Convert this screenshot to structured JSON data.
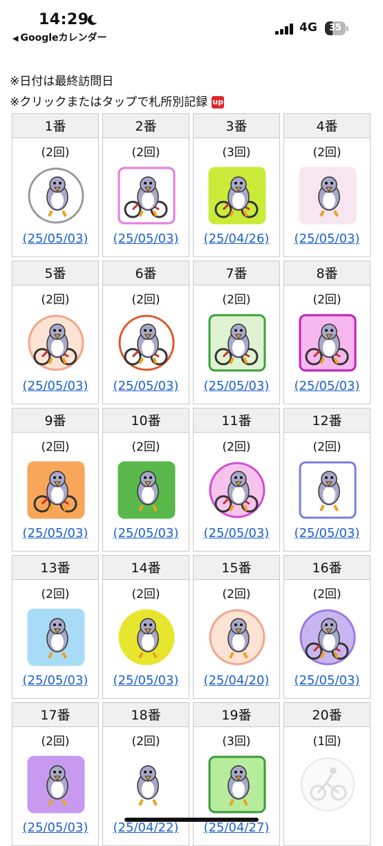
{
  "status_bar": {
    "time": "14:29",
    "back_label": "Googleカレンダー",
    "network": "4G",
    "battery": "35",
    "battery_level": 0.35
  },
  "notes": {
    "line1": "※日付は最終訪問日",
    "line2": "※クリックまたはタップで札所別記録",
    "badge": "up"
  },
  "temples": [
    {
      "number": "1番",
      "visits": "(2回)",
      "date": "(25/05/03)",
      "icon": "pilgrim-penguin-hat",
      "bg": "#ffffff",
      "ring": "#9a9a9a",
      "shape": "circle"
    },
    {
      "number": "2番",
      "visits": "(2回)",
      "date": "(25/05/03)",
      "icon": "penguin-bicycle",
      "bg": "#ffffff",
      "ring": "#e77ae0",
      "shape": "square"
    },
    {
      "number": "3番",
      "visits": "(3回)",
      "date": "(25/04/26)",
      "icon": "penguin-bicycle-front",
      "bg": "#c9ec3a",
      "ring": "#c9ec3a",
      "shape": "square"
    },
    {
      "number": "4番",
      "visits": "(2回)",
      "date": "(25/05/03)",
      "icon": "penguin-cherry-blossom",
      "bg": "#f7e6f0",
      "ring": "#f7e6f0",
      "shape": "square"
    },
    {
      "number": "5番",
      "visits": "(2回)",
      "date": "(25/05/03)",
      "icon": "penguin-red-bicycle",
      "bg": "#fde3d4",
      "ring": "#f2a58a",
      "shape": "circle"
    },
    {
      "number": "6番",
      "visits": "(2回)",
      "date": "(25/05/03)",
      "icon": "penguin-riding-bicycle",
      "bg": "#ffffff",
      "ring": "#e2552a",
      "shape": "circle"
    },
    {
      "number": "7番",
      "visits": "(2回)",
      "date": "(25/05/03)",
      "icon": "penguin-bicycle-greenhouse",
      "bg": "#dff3d2",
      "ring": "#3aa13a",
      "shape": "square"
    },
    {
      "number": "8番",
      "visits": "(2回)",
      "date": "(25/05/03)",
      "icon": "penguin-helmet-bicycle",
      "bg": "#f6b8ee",
      "ring": "#c020b8",
      "shape": "square"
    },
    {
      "number": "9番",
      "visits": "(2回)",
      "date": "(25/05/03)",
      "icon": "penguin-bicycle-pump",
      "bg": "#f7a65a",
      "ring": "#f7a65a",
      "shape": "square"
    },
    {
      "number": "10番",
      "visits": "(2回)",
      "date": "(25/05/03)",
      "icon": "penguin-resting-grass",
      "bg": "#58b84a",
      "ring": "#58b84a",
      "shape": "square"
    },
    {
      "number": "11番",
      "visits": "(2回)",
      "date": "(25/05/03)",
      "icon": "penguin-bicycle-pink",
      "bg": "#f5c3ec",
      "ring": "#d24ad0",
      "shape": "circle"
    },
    {
      "number": "12番",
      "visits": "(2回)",
      "date": "(25/05/03)",
      "icon": "penguin-helmet-rock",
      "bg": "#ffffff",
      "ring": "#7c7ce6",
      "shape": "square"
    },
    {
      "number": "13番",
      "visits": "(2回)",
      "date": "(25/05/03)",
      "icon": "penguin-cooking",
      "bg": "#a8dcf6",
      "ring": "#a8dcf6",
      "shape": "square"
    },
    {
      "number": "14番",
      "visits": "(2回)",
      "date": "(25/05/03)",
      "icon": "penguin-udon-making",
      "bg": "#e7e62e",
      "ring": "#e7e62e",
      "shape": "circle"
    },
    {
      "number": "15番",
      "visits": "(2回)",
      "date": "(25/04/20)",
      "icon": "festival-float",
      "bg": "#fde3d4",
      "ring": "#f0a68b",
      "shape": "circle"
    },
    {
      "number": "16番",
      "visits": "(2回)",
      "date": "(25/05/03)",
      "icon": "penguin-bicycle-night",
      "bg": "#c8b6f0",
      "ring": "#9c7ae0",
      "shape": "circle"
    },
    {
      "number": "17番",
      "visits": "(2回)",
      "date": "(25/05/03)",
      "icon": "penguin-drinking",
      "bg": "#c79af0",
      "ring": "#c79af0",
      "shape": "square"
    },
    {
      "number": "18番",
      "visits": "(2回)",
      "date": "(25/04/22)",
      "icon": "pilgrim-penguins-walking",
      "bg": "#ffffff",
      "ring": "#ffffff",
      "shape": "square"
    },
    {
      "number": "19番",
      "visits": "(3回)",
      "date": "(25/04/27)",
      "icon": "penguin-towel",
      "bg": "#b6ec9c",
      "ring": "#3a9a3a",
      "shape": "square"
    },
    {
      "number": "20番",
      "visits": "(1回)",
      "date": "",
      "icon": "bicycle-placeholder-faded",
      "bg": "#ffffff",
      "ring": "#e6e6e6",
      "shape": "circle"
    }
  ]
}
